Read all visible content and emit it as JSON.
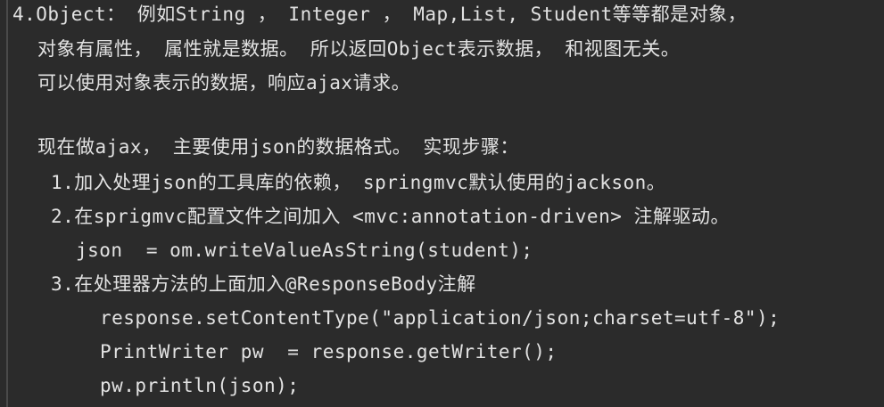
{
  "lines": [
    "4.Object： 例如String ， Integer ， Map,List, Student等等都是对象，",
    "对象有属性， 属性就是数据。 所以返回Object表示数据， 和视图无关。",
    "可以使用对象表示的数据，响应ajax请求。",
    "现在做ajax， 主要使用json的数据格式。 实现步骤：",
    "1.加入处理json的工具库的依赖， springmvc默认使用的jackson。",
    "2.在sprigmvc配置文件之间加入 <mvc:annotation-driven> 注解驱动。",
    "json  = om.writeValueAsString(student);",
    "3.在处理器方法的上面加入@ResponseBody注解",
    "response.setContentType(\"application/json;charset=utf-8\");",
    "PrintWriter pw  = response.getWriter();",
    "pw.println(json);"
  ]
}
